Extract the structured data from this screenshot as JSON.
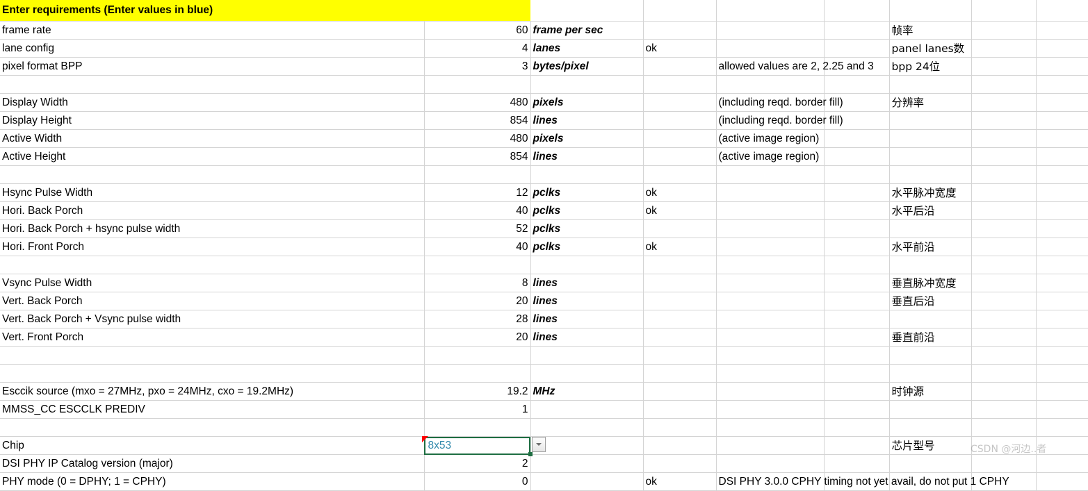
{
  "header": {
    "title": "Enter requirements (Enter values in blue)"
  },
  "watermark": "CSDN @河边..者",
  "columns": {
    "label": "",
    "value": "",
    "unit": "",
    "status": "",
    "note": "",
    "cjk": ""
  },
  "rows": [
    {
      "label": "frame rate",
      "label_color": "blue",
      "value": "60",
      "unit": "frame per sec",
      "status": "",
      "note": "",
      "cjk": "帧率"
    },
    {
      "label": "lane config",
      "label_color": "blue",
      "value": "4",
      "unit": "lanes",
      "status": "ok",
      "note": "",
      "cjk": "panel lanes数"
    },
    {
      "label": "pixel format BPP",
      "label_color": "blue",
      "value": "3",
      "unit": "bytes/pixel",
      "status": "",
      "note": "allowed values are 2, 2.25 and 3",
      "note_color": "red",
      "cjk": "bpp  24位"
    },
    {
      "label": "",
      "value": "",
      "unit": "",
      "status": "",
      "note": "",
      "cjk": ""
    },
    {
      "label": "Display Width",
      "label_color": "black",
      "value": "480",
      "unit": "pixels",
      "status": "",
      "note": "(including reqd. border fill)",
      "cjk": "分辨率"
    },
    {
      "label": "Display Height",
      "label_color": "black",
      "value": "854",
      "unit": "lines",
      "status": "",
      "note": "(including reqd. border fill)",
      "cjk": ""
    },
    {
      "label": "Active Width",
      "label_color": "blue",
      "value": "480",
      "unit": "pixels",
      "status": "",
      "note": "(active image region)",
      "cjk": ""
    },
    {
      "label": "Active Height",
      "label_color": "blue",
      "value": "854",
      "unit": "lines",
      "status": "",
      "note": "(active image region)",
      "cjk": ""
    },
    {
      "label": "",
      "value": "",
      "unit": "",
      "status": "",
      "note": "",
      "cjk": ""
    },
    {
      "label": "Hsync Pulse Width",
      "label_color": "blue",
      "value": "12",
      "unit": "pclks",
      "status": "ok",
      "note": "",
      "cjk": "水平脉冲宽度"
    },
    {
      "label": "Hori. Back Porch",
      "label_color": "blue",
      "value": "40",
      "unit": "pclks",
      "status": "ok",
      "note": "",
      "cjk": "水平后沿"
    },
    {
      "label": "Hori. Back Porch + hsync pulse width",
      "label_color": "black",
      "value": "52",
      "unit": "pclks",
      "status": "",
      "note": "",
      "cjk": ""
    },
    {
      "label": "Hori. Front Porch",
      "label_color": "blue",
      "value": "40",
      "unit": "pclks",
      "status": "ok",
      "note": "",
      "cjk": "水平前沿"
    },
    {
      "label": "",
      "value": "",
      "unit": "",
      "status": "",
      "note": "",
      "cjk": ""
    },
    {
      "label": "Vsync Pulse Width",
      "label_color": "blue",
      "value": "8",
      "unit": "lines",
      "status": "",
      "note": "",
      "cjk": "垂直脉冲宽度"
    },
    {
      "label": "Vert. Back Porch",
      "label_color": "blue",
      "value": "20",
      "unit": "lines",
      "status": "",
      "note": "",
      "cjk": "垂直后沿"
    },
    {
      "label": "Vert. Back Porch + Vsync pulse width",
      "label_color": "black",
      "value": "28",
      "unit": "lines",
      "status": "",
      "note": "",
      "cjk": ""
    },
    {
      "label": "Vert. Front Porch",
      "label_color": "blue",
      "value": "20",
      "unit": "lines",
      "status": "",
      "note": "",
      "cjk": "垂直前沿"
    },
    {
      "label": "",
      "value": "",
      "unit": "",
      "status": "",
      "note": "",
      "cjk": ""
    },
    {
      "label": "",
      "value": "",
      "unit": "",
      "status": "",
      "note": "",
      "cjk": ""
    },
    {
      "label": "Esccik source (mxo = 27MHz, pxo = 24MHz, cxo = 19.2MHz)",
      "label_color": "blue",
      "value": "19.2",
      "unit": "MHz",
      "status": "",
      "note": "",
      "cjk": "时钟源"
    },
    {
      "label": "MMSS_CC ESCCLK PREDIV",
      "label_color": "blue",
      "value": "1",
      "unit": "",
      "status": "",
      "note": "",
      "cjk": "",
      "comment_left": true,
      "comment_right": true
    },
    {
      "label": "",
      "value": "",
      "unit": "",
      "status": "",
      "note": "",
      "cjk": ""
    },
    {
      "label": "Chip",
      "label_color": "blue",
      "value": "8x53",
      "unit": "",
      "status": "",
      "note": "",
      "cjk": "芯片型号",
      "selected": true,
      "dropdown": true,
      "comment_left": true
    },
    {
      "label": "DSI PHY IP Catalog version (major)",
      "label_color": "black",
      "value": "2",
      "unit": "",
      "status": "",
      "note": "",
      "cjk": ""
    },
    {
      "label": "PHY mode (0 = DPHY; 1 = CPHY)",
      "label_color": "blue",
      "value": "0",
      "unit": "",
      "status": "ok",
      "note": "DSI PHY 3.0.0 CPHY timing not yet avail, do not put 1 CPHY",
      "note_color": "black",
      "cjk": ""
    }
  ]
}
